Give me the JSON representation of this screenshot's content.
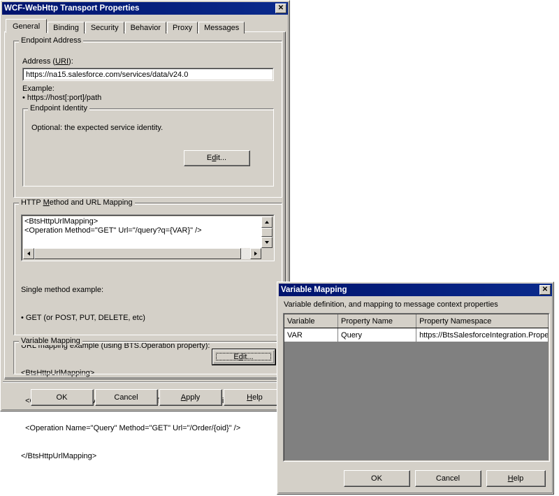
{
  "main_dialog": {
    "title": "WCF-WebHttp Transport Properties",
    "close_icon": "close-icon",
    "tabs": [
      {
        "label": "General",
        "selected": true
      },
      {
        "label": "Binding",
        "selected": false
      },
      {
        "label": "Security",
        "selected": false
      },
      {
        "label": "Behavior",
        "selected": false
      },
      {
        "label": "Proxy",
        "selected": false
      },
      {
        "label": "Messages",
        "selected": false
      }
    ],
    "endpoint_address": {
      "group_label": "Endpoint Address",
      "address_label_pre": "Address (",
      "address_label_acc": "URI",
      "address_label_post": "):",
      "address_value": "https://na15.salesforce.com/services/data/v24.0",
      "example_label": "Example:",
      "example_value": "•  https://host[:port]/path",
      "identity": {
        "group_label": "Endpoint Identity",
        "description": "Optional: the expected service identity.",
        "edit_button_pre": "E",
        "edit_button_acc": "d",
        "edit_button_post": "it..."
      }
    },
    "url_mapping": {
      "group_label_pre": "HTTP ",
      "group_label_acc": "M",
      "group_label_post": "ethod and URL Mapping",
      "editor_value": "<BtsHttpUrlMapping>\n<Operation Method=\"GET\" Url=\"/query?q={VAR}\" />",
      "help_lines": [
        "Single method example:",
        "• GET (or POST, PUT, DELETE, etc)",
        "URL mapping example (using BTS.Operation property):",
        "<BtsHttpUrlMapping>",
        "  <Operation Name=\"Add\" Method=\"PUT\" Url=\"/Customer/{id}\" />",
        "  <Operation Name=\"Query\" Method=\"GET\" Url=\"/Order/{oid}\" />",
        "</BtsHttpUrlMapping>"
      ]
    },
    "variable_mapping": {
      "group_label": "Variable Mapping",
      "edit_button_pre": "E",
      "edit_button_acc": "d",
      "edit_button_post": "it..."
    },
    "buttons": [
      {
        "label_pre": "OK",
        "label_acc": "",
        "label_post": ""
      },
      {
        "label_pre": "Cancel",
        "label_acc": "",
        "label_post": ""
      },
      {
        "label_pre": "",
        "label_acc": "A",
        "label_post": "pply"
      },
      {
        "label_pre": "",
        "label_acc": "H",
        "label_post": "elp"
      }
    ]
  },
  "variable_dialog": {
    "title": "Variable Mapping",
    "close_icon": "close-icon",
    "description": "Variable definition, and mapping to message context properties",
    "grid": {
      "columns": [
        "Variable",
        "Property Name",
        "Property Namespace"
      ],
      "rows": [
        {
          "variable": "VAR",
          "property_name": "Query",
          "property_namespace": "https://BtsSalesforceIntegration.Proper"
        }
      ]
    },
    "buttons": [
      {
        "label_pre": "OK",
        "label_acc": "",
        "label_post": ""
      },
      {
        "label_pre": "Cancel",
        "label_acc": "",
        "label_post": ""
      },
      {
        "label_pre": "",
        "label_acc": "H",
        "label_post": "elp"
      }
    ]
  },
  "colors": {
    "titlebar": "#00146e",
    "face": "#d4d0c8",
    "grid_empty": "#808080",
    "field": "#ffffff"
  }
}
